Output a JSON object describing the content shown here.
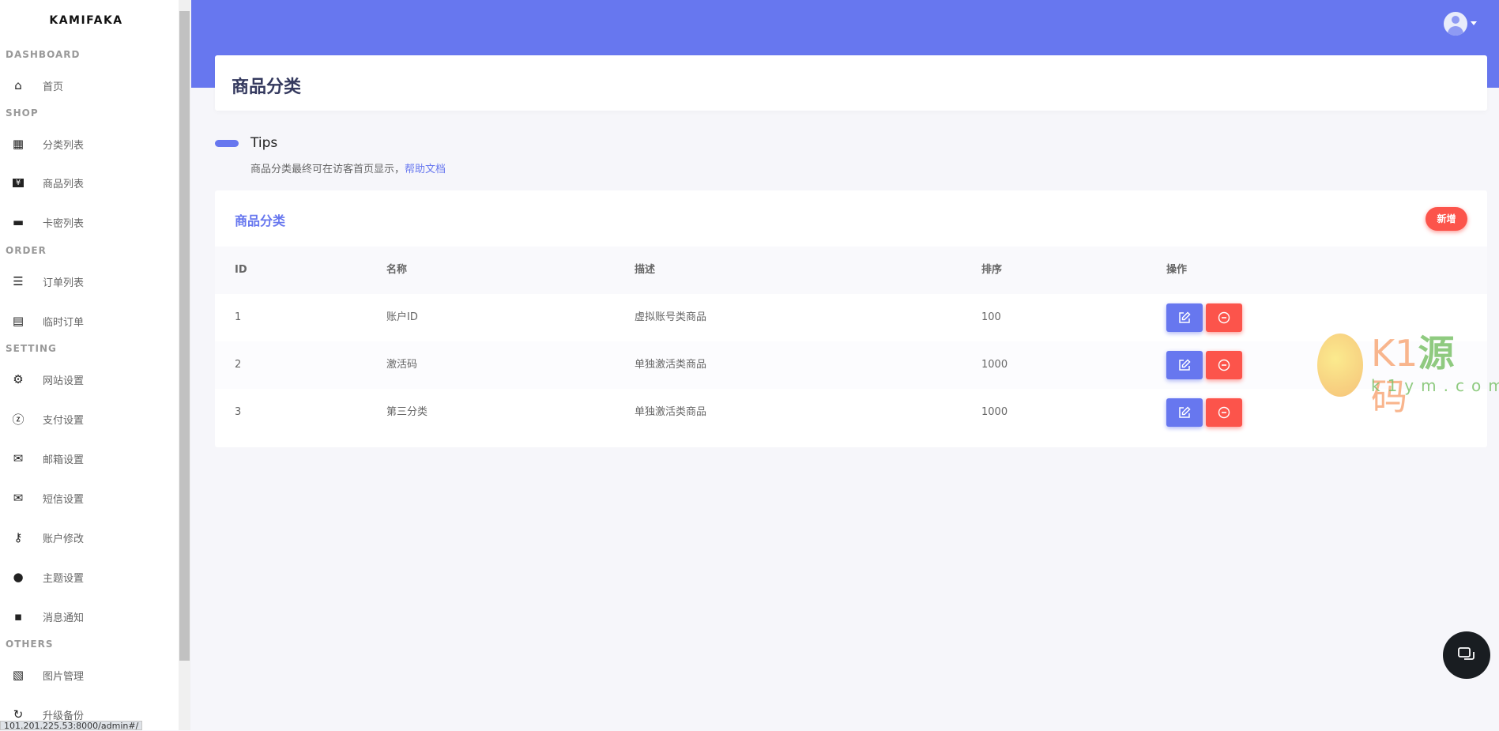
{
  "sidebar": {
    "brand": "KAMIFAKA",
    "sections": [
      {
        "label": "DASHBOARD"
      },
      {
        "label": "SHOP"
      },
      {
        "label": "ORDER"
      },
      {
        "label": "SETTING"
      },
      {
        "label": "OTHERS"
      }
    ],
    "items": [
      {
        "label": "首页",
        "icon": "home-icon"
      },
      {
        "label": "分类列表",
        "icon": "category-icon"
      },
      {
        "label": "商品列表",
        "icon": "yen-ticket-icon"
      },
      {
        "label": "卡密列表",
        "icon": "card-icon"
      },
      {
        "label": "订单列表",
        "icon": "sort-list-icon"
      },
      {
        "label": "临时订单",
        "icon": "list-alt-icon"
      },
      {
        "label": "网站设置",
        "icon": "gear-icon"
      },
      {
        "label": "支付设置",
        "icon": "alipay-icon"
      },
      {
        "label": "邮箱设置",
        "icon": "envelope-open-icon"
      },
      {
        "label": "短信设置",
        "icon": "envelope-icon"
      },
      {
        "label": "账户修改",
        "icon": "key-icon"
      },
      {
        "label": "主题设置",
        "icon": "palette-icon"
      },
      {
        "label": "消息通知",
        "icon": "comment-dots-icon"
      },
      {
        "label": "图片管理",
        "icon": "image-icon"
      },
      {
        "label": "升级备份",
        "icon": "sync-icon"
      }
    ]
  },
  "header": {
    "title": "商品分类",
    "accent": "#6777ef"
  },
  "tips": {
    "title": "Tips",
    "text": "商品分类最终可在访客首页显示，",
    "link": "帮助文档"
  },
  "card": {
    "title": "商品分类",
    "add_label": "新增",
    "columns": [
      "ID",
      "名称",
      "描述",
      "排序",
      "操作"
    ],
    "rows": [
      {
        "id": "1",
        "name": "账户ID",
        "desc": "虚拟账号类商品",
        "sort": "100"
      },
      {
        "id": "2",
        "name": "激活码",
        "desc": "单独激活类商品",
        "sort": "1000"
      },
      {
        "id": "3",
        "name": "第三分类",
        "desc": "单独激活类商品",
        "sort": "1000"
      }
    ]
  },
  "watermark": {
    "text": "K1源码",
    "url": "k1ym.com"
  },
  "status_url": "101.201.225.53:8000/admin#/",
  "colors": {
    "primary": "#6777ef",
    "danger": "#fc544b"
  }
}
